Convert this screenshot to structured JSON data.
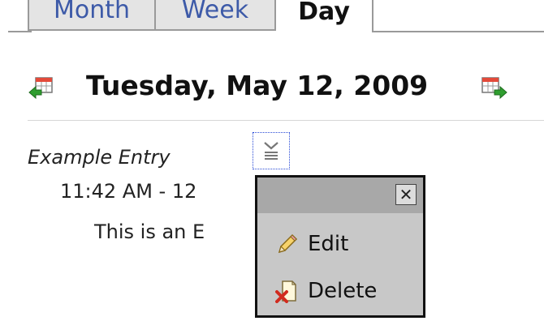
{
  "tabs": [
    {
      "label": "Month"
    },
    {
      "label": "Week"
    },
    {
      "label": "Day"
    }
  ],
  "day": {
    "title": "Tuesday, May 12, 2009"
  },
  "entry": {
    "title": "Example Entry",
    "time_visible": "11:42 AM - 12",
    "description_visible": "This is an E"
  },
  "popup": {
    "close_label": "✕",
    "items": [
      {
        "label": "Edit",
        "icon": "pencil-icon"
      },
      {
        "label": "Delete",
        "icon": "delete-doc-icon"
      }
    ]
  },
  "colors": {
    "tab_link": "#3d5aa8",
    "popup_bg": "#c8c8c8",
    "popup_bar": "#a8a8a8"
  }
}
